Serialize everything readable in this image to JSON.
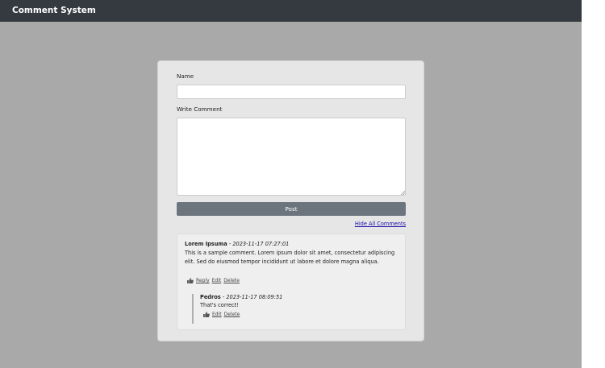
{
  "app": {
    "title": "Comment System"
  },
  "form": {
    "name_label": "Name",
    "name_value": "",
    "comment_label": "Write Comment",
    "comment_value": "",
    "post_label": "Post"
  },
  "hide_all_label": "Hide All Comments",
  "comments": [
    {
      "author": "Lorem Ipsuma",
      "separator": " - ",
      "timestamp": "2023-11-17 07:27:01",
      "body": "This is a sample comment. Lorem ipsum dolor sit amet, consectetur adipiscing elit. Sed do eiusmod tempor incididunt ut labore et dolore magna aliqua.",
      "actions": {
        "reply": "Reply",
        "edit": "Edit",
        "delete": "Delete"
      },
      "replies": [
        {
          "author": "Pedros",
          "separator": " - ",
          "timestamp": "2023-11-17 08:09:51",
          "body": "That's correct!",
          "actions": {
            "edit": "Edit",
            "delete": "Delete"
          }
        }
      ]
    }
  ],
  "colors": {
    "topbar": "#343a40",
    "background": "#a9a9a9",
    "card": "#e6e6e6",
    "button": "#6c757d",
    "link": "#1a0dab"
  },
  "icons": {
    "like": "thumbs-up-icon"
  }
}
